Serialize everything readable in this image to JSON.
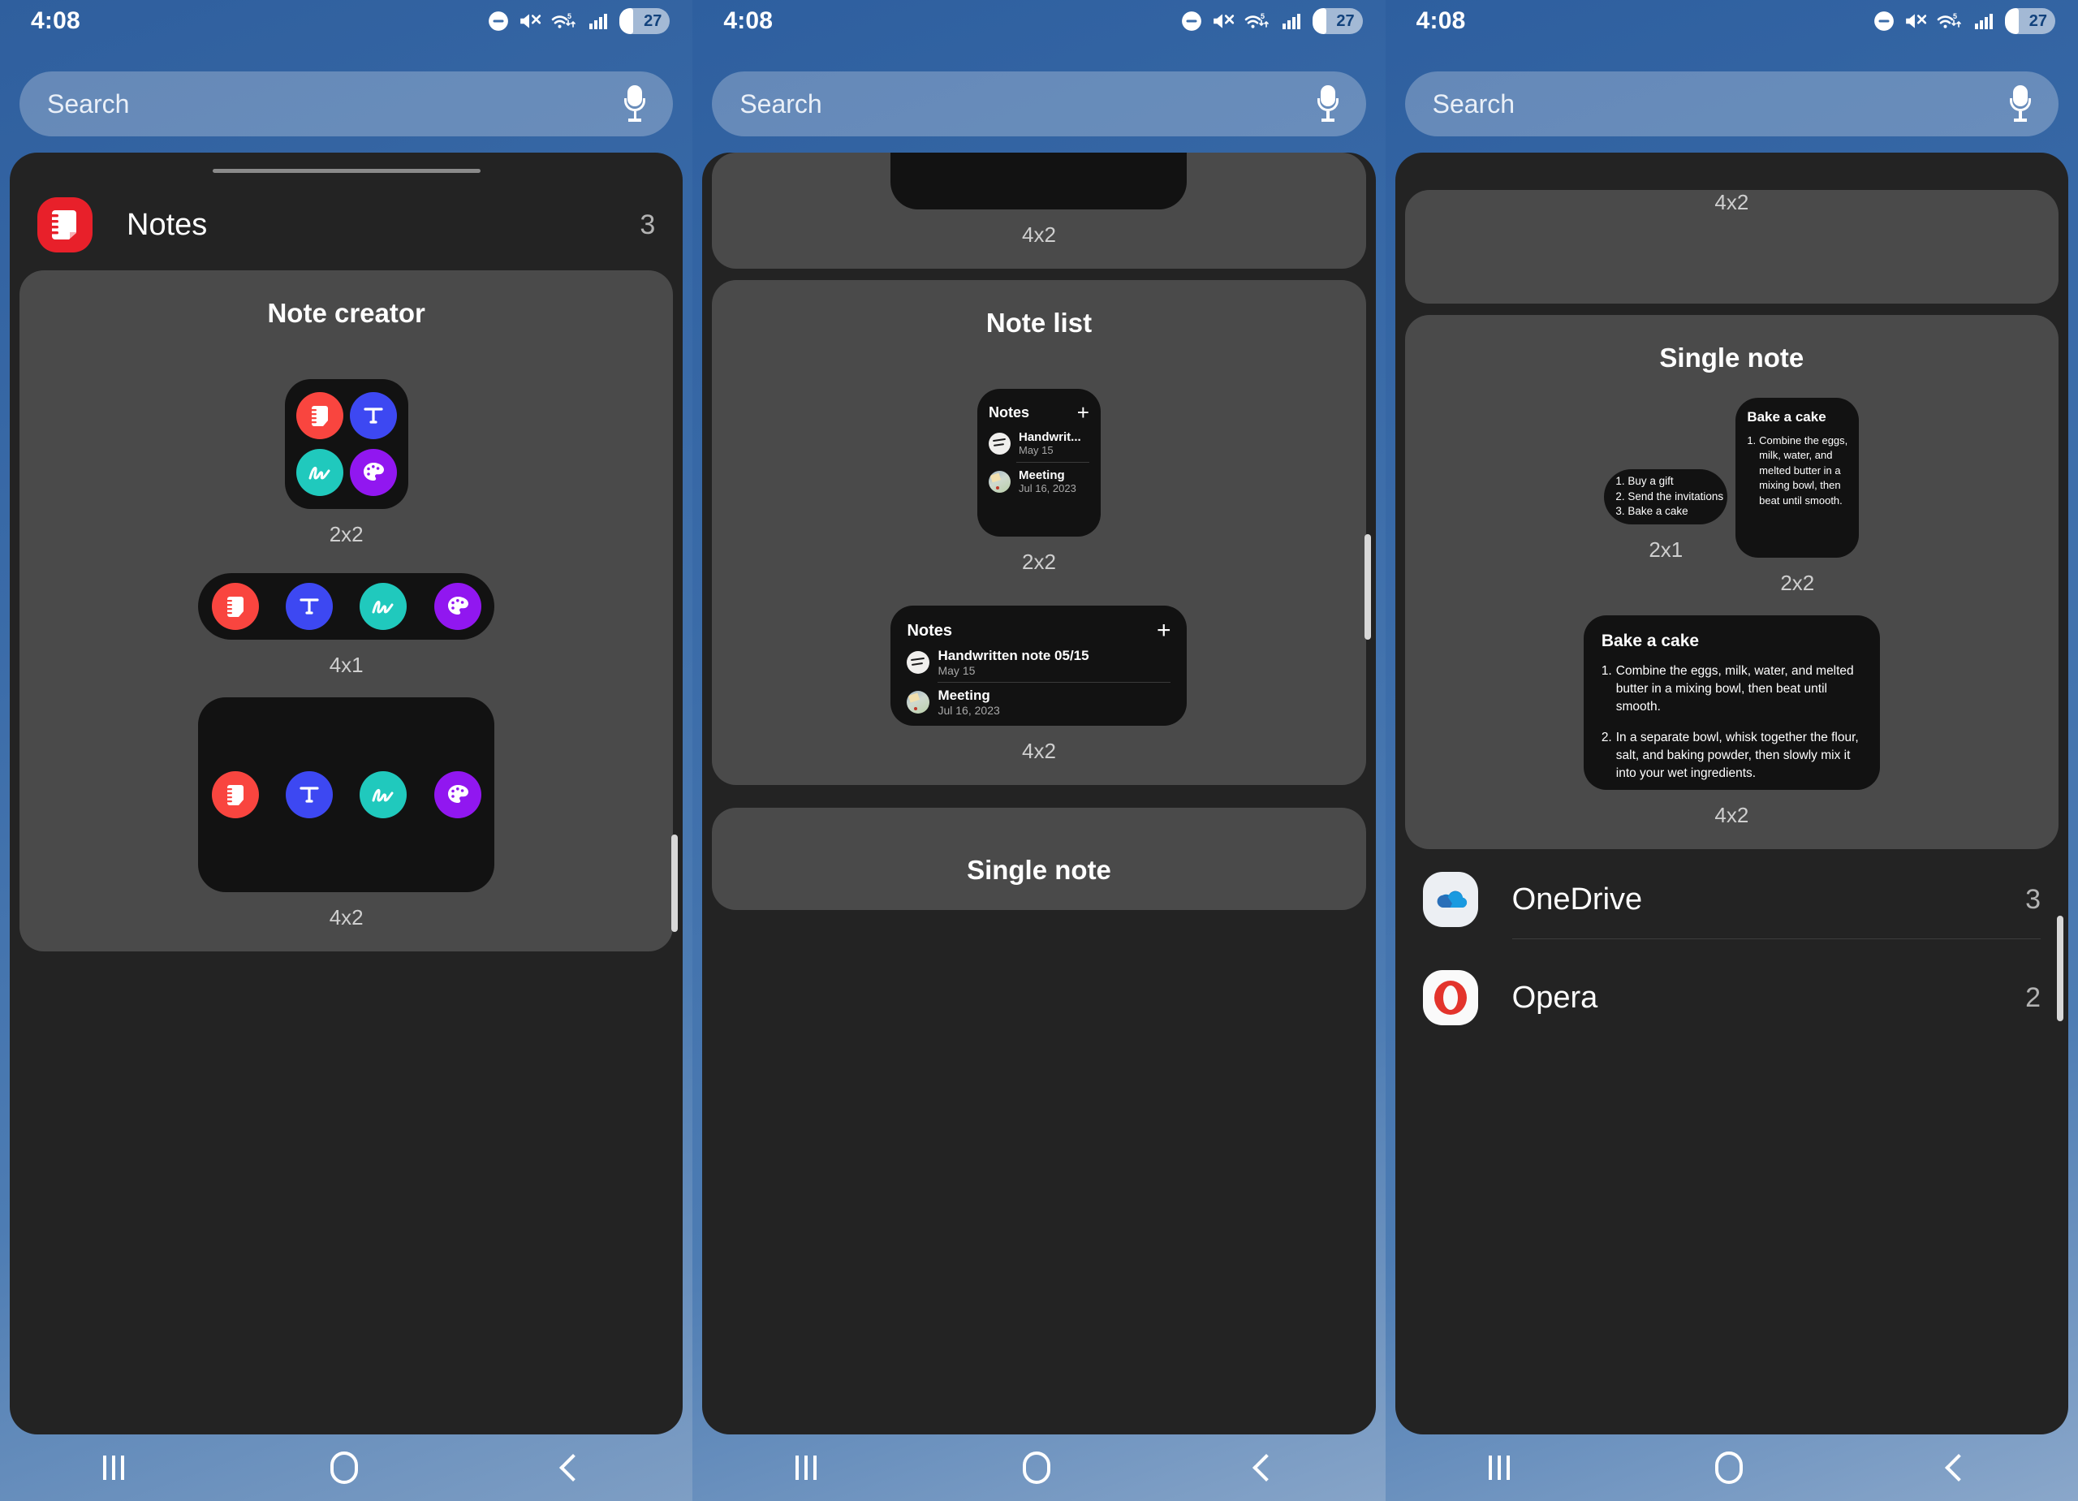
{
  "status": {
    "time": "4:08",
    "battery_level": "27",
    "icons": [
      "do-not-disturb-icon",
      "mute-icon",
      "wifi-5g-icon",
      "cellular-signal-icon",
      "battery-icon"
    ]
  },
  "search": {
    "placeholder": "Search",
    "mic": "microphone-icon"
  },
  "apps": {
    "notes": {
      "name": "Notes",
      "count": "3"
    },
    "onedrive": {
      "name": "OneDrive",
      "count": "3"
    },
    "opera": {
      "name": "Opera",
      "count": "2"
    }
  },
  "groups": {
    "note_creator": {
      "title": "Note creator"
    },
    "note_list": {
      "title": "Note list"
    },
    "single_note": {
      "title": "Single note"
    }
  },
  "sizes": {
    "s2x1": "2x1",
    "s2x2": "2x2",
    "s4x1": "4x1",
    "s4x2": "4x2"
  },
  "creator_actions": [
    {
      "name": "new-note",
      "icon": "note-icon",
      "color": "#f9453f"
    },
    {
      "name": "text-note",
      "icon": "text-T-icon",
      "color": "#3d48f2"
    },
    {
      "name": "handwriting-note",
      "icon": "handwriting-icon",
      "color": "#20c9bd"
    },
    {
      "name": "drawing-note",
      "icon": "palette-icon",
      "color": "#9117f0"
    }
  ],
  "note_list_widget": {
    "header": "Notes",
    "add": "+",
    "items": [
      {
        "title_short": "Handwrit...",
        "title_full": "Handwritten note 05/15",
        "date": "May 15",
        "thumb": "handwritten-thumbnail"
      },
      {
        "title_short": "Meeting",
        "title_full": "Meeting",
        "date": "Jul 16, 2023",
        "thumb": "meeting-photo-thumbnail"
      }
    ]
  },
  "note_2x1": {
    "lines": [
      "1. Buy a gift",
      "2. Send the invitations",
      "3. Bake a cake"
    ]
  },
  "note_2x2": {
    "title": "Bake a cake",
    "items": [
      {
        "num": "1.",
        "text": "Combine the eggs, milk, water, and melted butter in a mixing bowl, then beat until smooth."
      }
    ]
  },
  "note_4x2": {
    "title": "Bake a cake",
    "items": [
      {
        "num": "1.",
        "text": "Combine the eggs, milk, water, and melted butter in a mixing bowl, then beat until smooth."
      },
      {
        "num": "2.",
        "text": "In a separate bowl, whisk together the flour, salt, and baking powder, then slowly mix it into your wet ingredients."
      }
    ]
  },
  "navbar": {
    "recents": "recent-apps-icon",
    "home": "home-icon",
    "back": "back-icon"
  },
  "colors": {
    "accent_red": "#e8202a",
    "sheet_bg": "#232323",
    "group_bg": "#4a4a4a",
    "widget_bg": "#121212"
  }
}
